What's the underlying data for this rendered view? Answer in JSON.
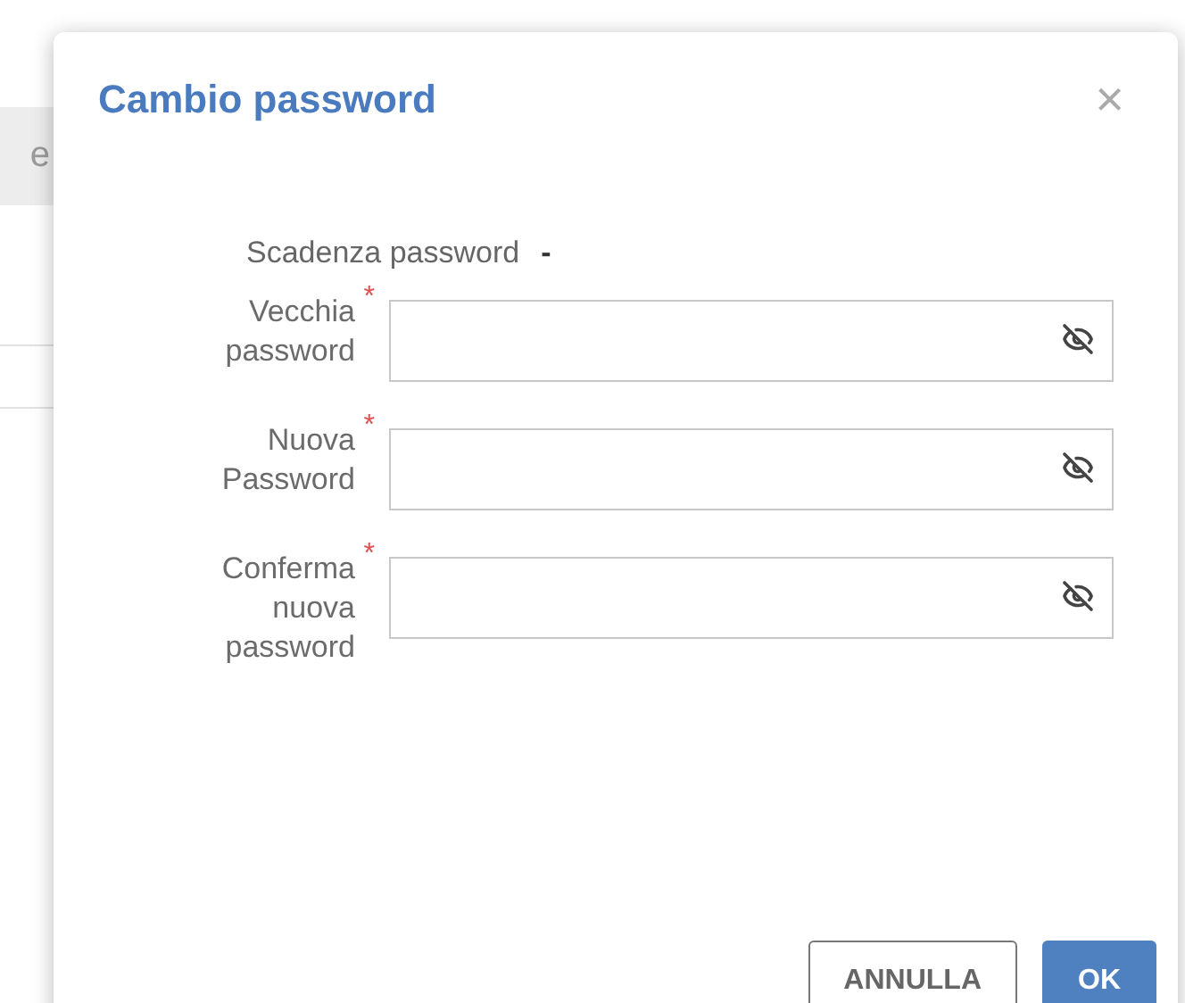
{
  "background": {
    "header_text": "e"
  },
  "dialog": {
    "title": "Cambio password",
    "close": "×",
    "expiry": {
      "label": "Scadenza password",
      "value": "-"
    },
    "fields": [
      {
        "label": "Vecchia password",
        "required": true,
        "required_mark": "*"
      },
      {
        "label": "Nuova Password",
        "required": true,
        "required_mark": "*"
      },
      {
        "label": "Conferma nuova password",
        "required": true,
        "required_mark": "*"
      }
    ],
    "buttons": [
      {
        "label": "ANNULLA",
        "kind": "secondary"
      },
      {
        "label": "OK",
        "kind": "primary"
      }
    ]
  }
}
